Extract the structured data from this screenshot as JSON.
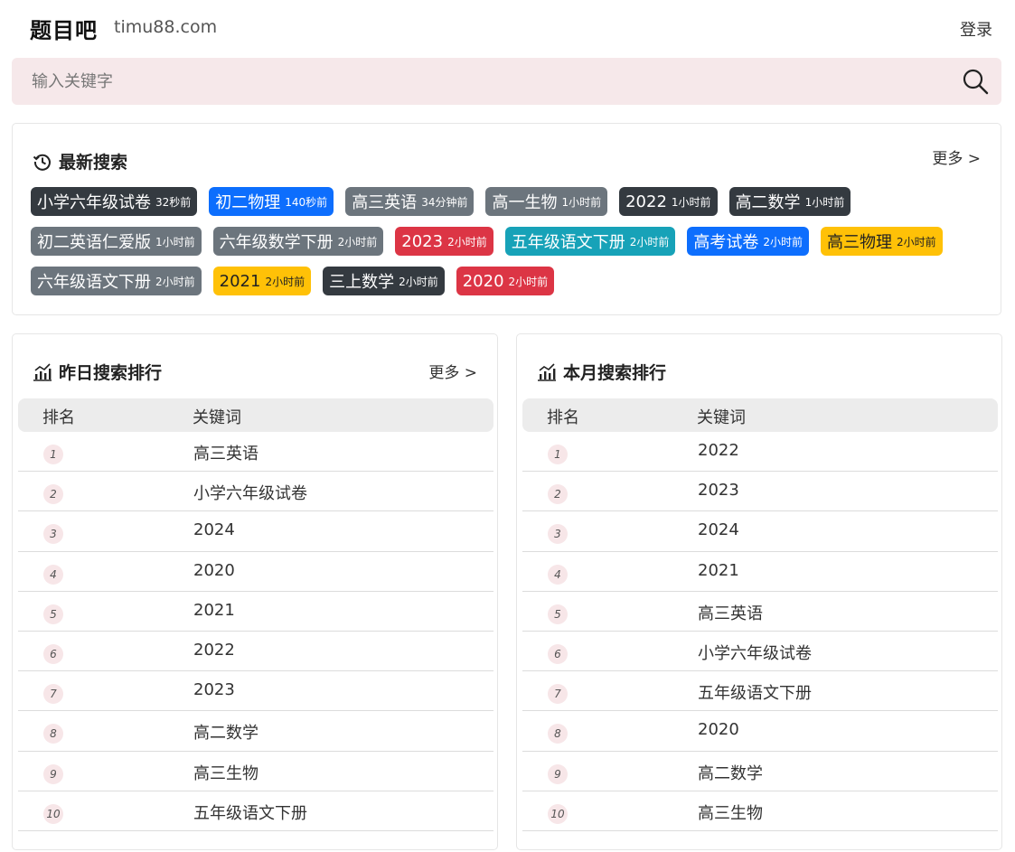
{
  "header": {
    "brand": "题目吧",
    "domain": "timu88.com",
    "login": "登录"
  },
  "search": {
    "placeholder": "输入关键字"
  },
  "latest": {
    "title": "最新搜索",
    "more": "更多 >",
    "tags": [
      {
        "text": "小学六年级试卷",
        "time": "32秒前",
        "color": "dark"
      },
      {
        "text": "初二物理",
        "time": "140秒前",
        "color": "blue"
      },
      {
        "text": "高三英语",
        "time": "34分钟前",
        "color": "grey"
      },
      {
        "text": "高一生物",
        "time": "1小时前",
        "color": "grey"
      },
      {
        "text": "2022",
        "time": "1小时前",
        "color": "dark"
      },
      {
        "text": "高二数学",
        "time": "1小时前",
        "color": "dark"
      },
      {
        "text": "初二英语仁爱版",
        "time": "1小时前",
        "color": "grey"
      },
      {
        "text": "六年级数学下册",
        "time": "2小时前",
        "color": "grey"
      },
      {
        "text": "2023",
        "time": "2小时前",
        "color": "red"
      },
      {
        "text": "五年级语文下册",
        "time": "2小时前",
        "color": "teal"
      },
      {
        "text": "高考试卷",
        "time": "2小时前",
        "color": "blue"
      },
      {
        "text": "高三物理",
        "time": "2小时前",
        "color": "yellow"
      },
      {
        "text": "六年级语文下册",
        "time": "2小时前",
        "color": "grey"
      },
      {
        "text": "2021",
        "time": "2小时前",
        "color": "yellow"
      },
      {
        "text": "三上数学",
        "time": "2小时前",
        "color": "dark"
      },
      {
        "text": "2020",
        "time": "2小时前",
        "color": "red"
      }
    ]
  },
  "yesterday": {
    "title": "昨日搜索排行",
    "more": "更多 >",
    "col_rank": "排名",
    "col_keyword": "关键词",
    "rows": [
      {
        "rank": "1",
        "keyword": "高三英语"
      },
      {
        "rank": "2",
        "keyword": "小学六年级试卷"
      },
      {
        "rank": "3",
        "keyword": "2024"
      },
      {
        "rank": "4",
        "keyword": "2020"
      },
      {
        "rank": "5",
        "keyword": "2021"
      },
      {
        "rank": "6",
        "keyword": "2022"
      },
      {
        "rank": "7",
        "keyword": "2023"
      },
      {
        "rank": "8",
        "keyword": "高二数学"
      },
      {
        "rank": "9",
        "keyword": "高三生物"
      },
      {
        "rank": "10",
        "keyword": "五年级语文下册"
      }
    ]
  },
  "month": {
    "title": "本月搜索排行",
    "col_rank": "排名",
    "col_keyword": "关键词",
    "rows": [
      {
        "rank": "1",
        "keyword": "2022"
      },
      {
        "rank": "2",
        "keyword": "2023"
      },
      {
        "rank": "3",
        "keyword": "2024"
      },
      {
        "rank": "4",
        "keyword": "2021"
      },
      {
        "rank": "5",
        "keyword": "高三英语"
      },
      {
        "rank": "6",
        "keyword": "小学六年级试卷"
      },
      {
        "rank": "7",
        "keyword": "五年级语文下册"
      },
      {
        "rank": "8",
        "keyword": "2020"
      },
      {
        "rank": "9",
        "keyword": "高二数学"
      },
      {
        "rank": "10",
        "keyword": "高三生物"
      }
    ]
  },
  "icons": {
    "search": "search-icon",
    "latest": "history-icon",
    "ranking": "bar-chart-icon"
  }
}
